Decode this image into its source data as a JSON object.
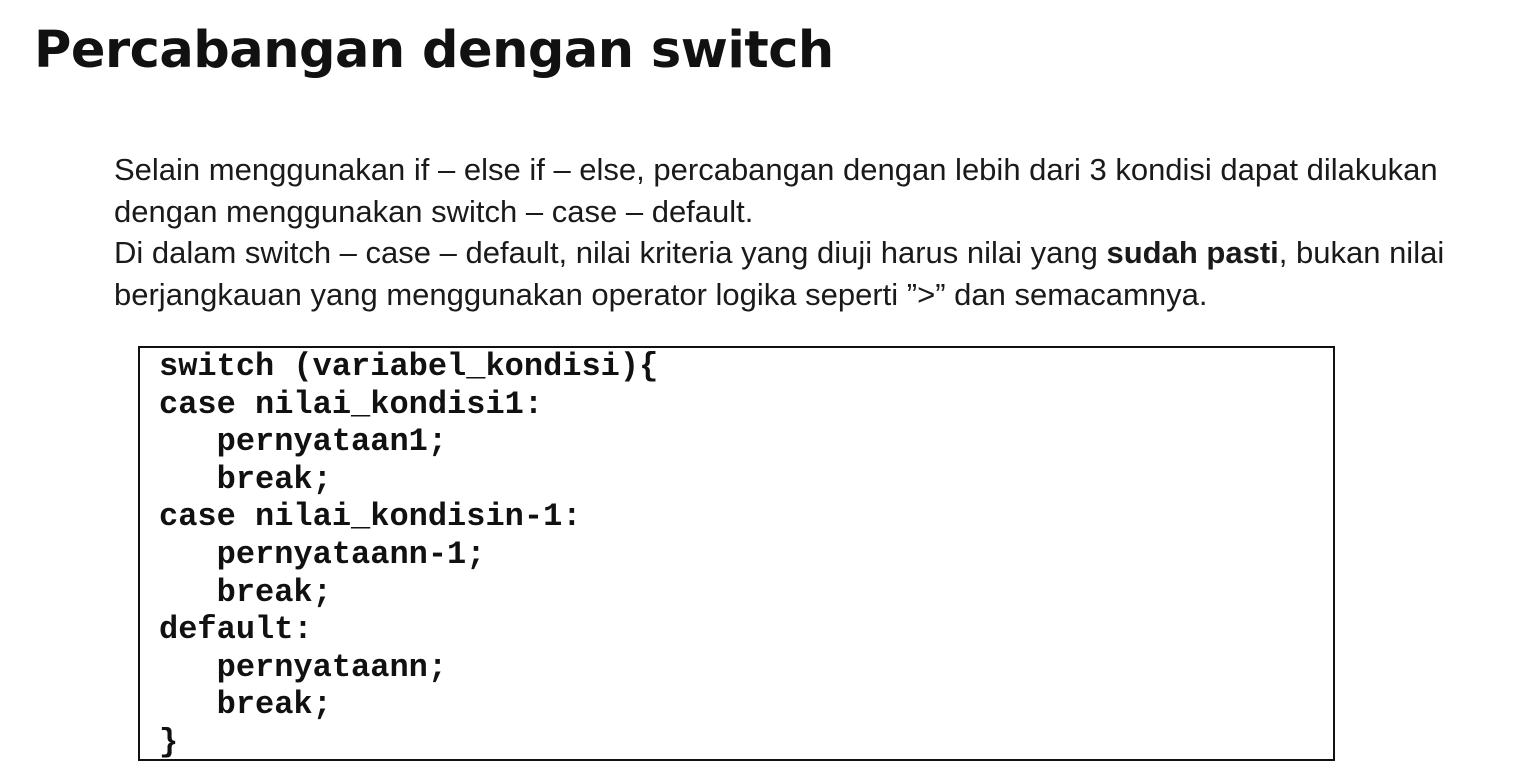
{
  "slide": {
    "title": "Percabangan dengan switch",
    "paragraph1": "Selain menggunakan if – else if – else, percabangan dengan lebih dari 3 kondisi dapat dilakukan dengan menggunakan switch – case – default.",
    "paragraph2_before": "Di dalam switch – case – default, nilai kriteria yang diuji harus nilai yang ",
    "paragraph2_bold": "sudah pasti",
    "paragraph2_after": ", bukan nilai berjangkauan yang menggunakan operator logika seperti ”>” dan semacamnya."
  },
  "code": {
    "lines": [
      "switch (variabel_kondisi){",
      "case nilai_kondisi1:",
      "   pernyataan1;",
      "   break;",
      "case nilai_kondisin-1:",
      "   pernyataann-1;",
      "   break;",
      "default:",
      "   pernyataann;",
      "   break;",
      "}"
    ]
  }
}
